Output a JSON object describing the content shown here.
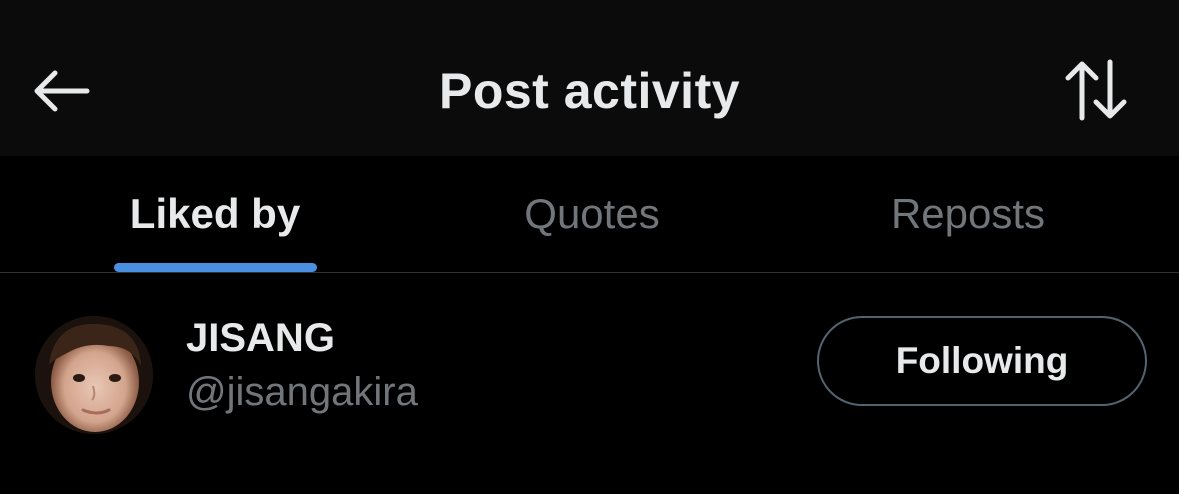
{
  "header": {
    "title": "Post activity",
    "back_icon": "arrow-left-icon",
    "sort_icon": "sort-arrows-icon"
  },
  "tabs": [
    {
      "label": "Liked by",
      "active": true
    },
    {
      "label": "Quotes",
      "active": false
    },
    {
      "label": "Reposts",
      "active": false
    }
  ],
  "users": [
    {
      "display_name": "JISANG",
      "handle": "@jisangakira",
      "follow_label": "Following"
    }
  ],
  "colors": {
    "accent": "#4a90e2",
    "background": "#000000",
    "text_primary": "#e7e9ea",
    "text_secondary": "#71767b"
  }
}
